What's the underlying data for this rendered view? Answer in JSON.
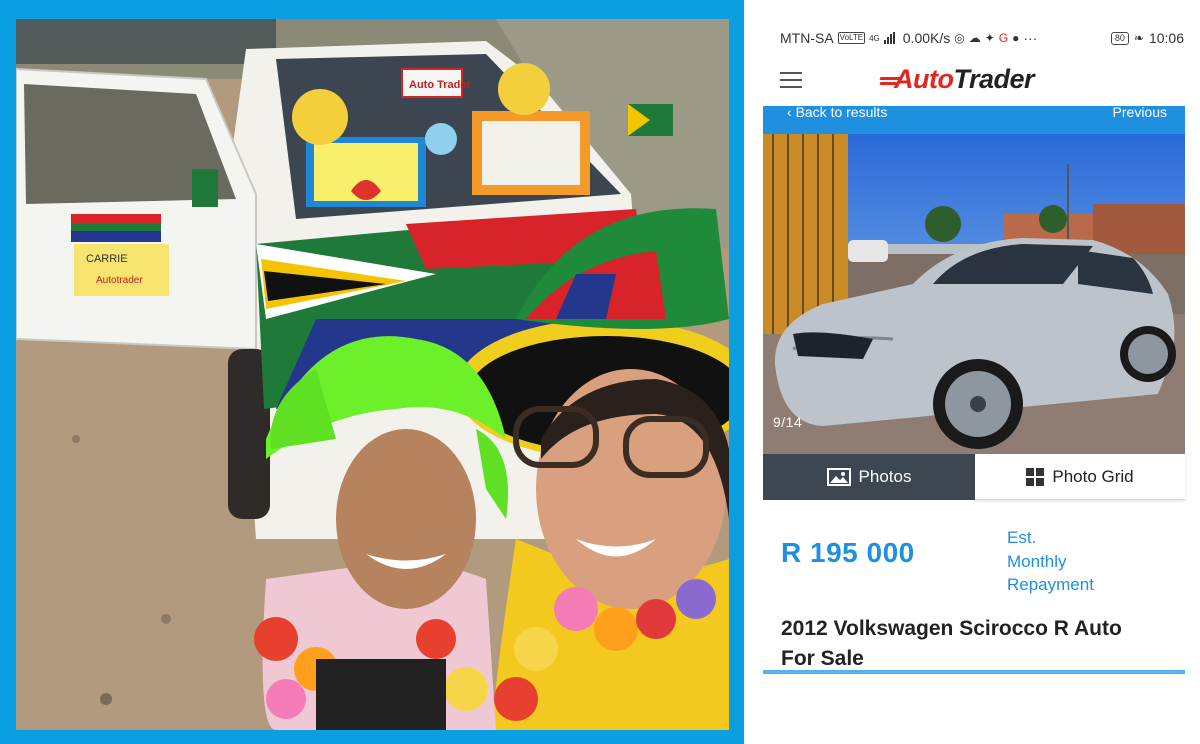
{
  "photo": {
    "sign_top": "Auto Trader",
    "door_sign_name": "CARRIE",
    "door_sign_brand": "Autotrader"
  },
  "status_bar": {
    "carrier": "MTN-SA",
    "net_badge": "VoLTE",
    "net_type": "4G",
    "speed": "0.00K/s",
    "battery": "80",
    "time": "10:06",
    "more": "···"
  },
  "app": {
    "menu_icon": "hamburger-icon",
    "logo_auto": "Auto",
    "logo_trader": "Trader"
  },
  "nav": {
    "back_label": "Back to results",
    "previous_label": "Previous"
  },
  "gallery": {
    "counter": "9/14",
    "tab_photos": "Photos",
    "tab_grid": "Photo Grid"
  },
  "listing": {
    "price": "R 195 000",
    "est_line1": "Est.",
    "est_line2": "Monthly",
    "est_line3": "Repayment",
    "title_line1": "2012 Volkswagen Scirocco R Auto",
    "title_line2": "For Sale"
  },
  "colors": {
    "frame_blue": "#0a9fe2",
    "brand_red": "#e2261c",
    "accent_blue": "#1f8fe0",
    "tab_dark": "#3d4751"
  }
}
